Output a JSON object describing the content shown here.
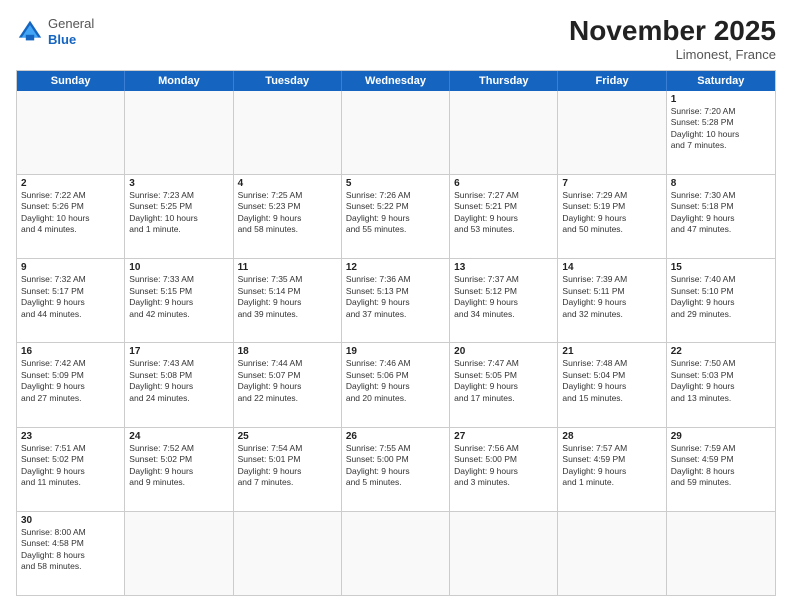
{
  "header": {
    "logo_general": "General",
    "logo_blue": "Blue",
    "month_title": "November 2025",
    "location": "Limonest, France"
  },
  "days": [
    "Sunday",
    "Monday",
    "Tuesday",
    "Wednesday",
    "Thursday",
    "Friday",
    "Saturday"
  ],
  "rows": [
    [
      {
        "date": "",
        "info": ""
      },
      {
        "date": "",
        "info": ""
      },
      {
        "date": "",
        "info": ""
      },
      {
        "date": "",
        "info": ""
      },
      {
        "date": "",
        "info": ""
      },
      {
        "date": "",
        "info": ""
      },
      {
        "date": "1",
        "info": "Sunrise: 7:20 AM\nSunset: 5:28 PM\nDaylight: 10 hours\nand 7 minutes."
      }
    ],
    [
      {
        "date": "2",
        "info": "Sunrise: 7:22 AM\nSunset: 5:26 PM\nDaylight: 10 hours\nand 4 minutes."
      },
      {
        "date": "3",
        "info": "Sunrise: 7:23 AM\nSunset: 5:25 PM\nDaylight: 10 hours\nand 1 minute."
      },
      {
        "date": "4",
        "info": "Sunrise: 7:25 AM\nSunset: 5:23 PM\nDaylight: 9 hours\nand 58 minutes."
      },
      {
        "date": "5",
        "info": "Sunrise: 7:26 AM\nSunset: 5:22 PM\nDaylight: 9 hours\nand 55 minutes."
      },
      {
        "date": "6",
        "info": "Sunrise: 7:27 AM\nSunset: 5:21 PM\nDaylight: 9 hours\nand 53 minutes."
      },
      {
        "date": "7",
        "info": "Sunrise: 7:29 AM\nSunset: 5:19 PM\nDaylight: 9 hours\nand 50 minutes."
      },
      {
        "date": "8",
        "info": "Sunrise: 7:30 AM\nSunset: 5:18 PM\nDaylight: 9 hours\nand 47 minutes."
      }
    ],
    [
      {
        "date": "9",
        "info": "Sunrise: 7:32 AM\nSunset: 5:17 PM\nDaylight: 9 hours\nand 44 minutes."
      },
      {
        "date": "10",
        "info": "Sunrise: 7:33 AM\nSunset: 5:15 PM\nDaylight: 9 hours\nand 42 minutes."
      },
      {
        "date": "11",
        "info": "Sunrise: 7:35 AM\nSunset: 5:14 PM\nDaylight: 9 hours\nand 39 minutes."
      },
      {
        "date": "12",
        "info": "Sunrise: 7:36 AM\nSunset: 5:13 PM\nDaylight: 9 hours\nand 37 minutes."
      },
      {
        "date": "13",
        "info": "Sunrise: 7:37 AM\nSunset: 5:12 PM\nDaylight: 9 hours\nand 34 minutes."
      },
      {
        "date": "14",
        "info": "Sunrise: 7:39 AM\nSunset: 5:11 PM\nDaylight: 9 hours\nand 32 minutes."
      },
      {
        "date": "15",
        "info": "Sunrise: 7:40 AM\nSunset: 5:10 PM\nDaylight: 9 hours\nand 29 minutes."
      }
    ],
    [
      {
        "date": "16",
        "info": "Sunrise: 7:42 AM\nSunset: 5:09 PM\nDaylight: 9 hours\nand 27 minutes."
      },
      {
        "date": "17",
        "info": "Sunrise: 7:43 AM\nSunset: 5:08 PM\nDaylight: 9 hours\nand 24 minutes."
      },
      {
        "date": "18",
        "info": "Sunrise: 7:44 AM\nSunset: 5:07 PM\nDaylight: 9 hours\nand 22 minutes."
      },
      {
        "date": "19",
        "info": "Sunrise: 7:46 AM\nSunset: 5:06 PM\nDaylight: 9 hours\nand 20 minutes."
      },
      {
        "date": "20",
        "info": "Sunrise: 7:47 AM\nSunset: 5:05 PM\nDaylight: 9 hours\nand 17 minutes."
      },
      {
        "date": "21",
        "info": "Sunrise: 7:48 AM\nSunset: 5:04 PM\nDaylight: 9 hours\nand 15 minutes."
      },
      {
        "date": "22",
        "info": "Sunrise: 7:50 AM\nSunset: 5:03 PM\nDaylight: 9 hours\nand 13 minutes."
      }
    ],
    [
      {
        "date": "23",
        "info": "Sunrise: 7:51 AM\nSunset: 5:02 PM\nDaylight: 9 hours\nand 11 minutes."
      },
      {
        "date": "24",
        "info": "Sunrise: 7:52 AM\nSunset: 5:02 PM\nDaylight: 9 hours\nand 9 minutes."
      },
      {
        "date": "25",
        "info": "Sunrise: 7:54 AM\nSunset: 5:01 PM\nDaylight: 9 hours\nand 7 minutes."
      },
      {
        "date": "26",
        "info": "Sunrise: 7:55 AM\nSunset: 5:00 PM\nDaylight: 9 hours\nand 5 minutes."
      },
      {
        "date": "27",
        "info": "Sunrise: 7:56 AM\nSunset: 5:00 PM\nDaylight: 9 hours\nand 3 minutes."
      },
      {
        "date": "28",
        "info": "Sunrise: 7:57 AM\nSunset: 4:59 PM\nDaylight: 9 hours\nand 1 minute."
      },
      {
        "date": "29",
        "info": "Sunrise: 7:59 AM\nSunset: 4:59 PM\nDaylight: 8 hours\nand 59 minutes."
      }
    ],
    [
      {
        "date": "30",
        "info": "Sunrise: 8:00 AM\nSunset: 4:58 PM\nDaylight: 8 hours\nand 58 minutes."
      },
      {
        "date": "",
        "info": ""
      },
      {
        "date": "",
        "info": ""
      },
      {
        "date": "",
        "info": ""
      },
      {
        "date": "",
        "info": ""
      },
      {
        "date": "",
        "info": ""
      },
      {
        "date": "",
        "info": ""
      }
    ]
  ]
}
